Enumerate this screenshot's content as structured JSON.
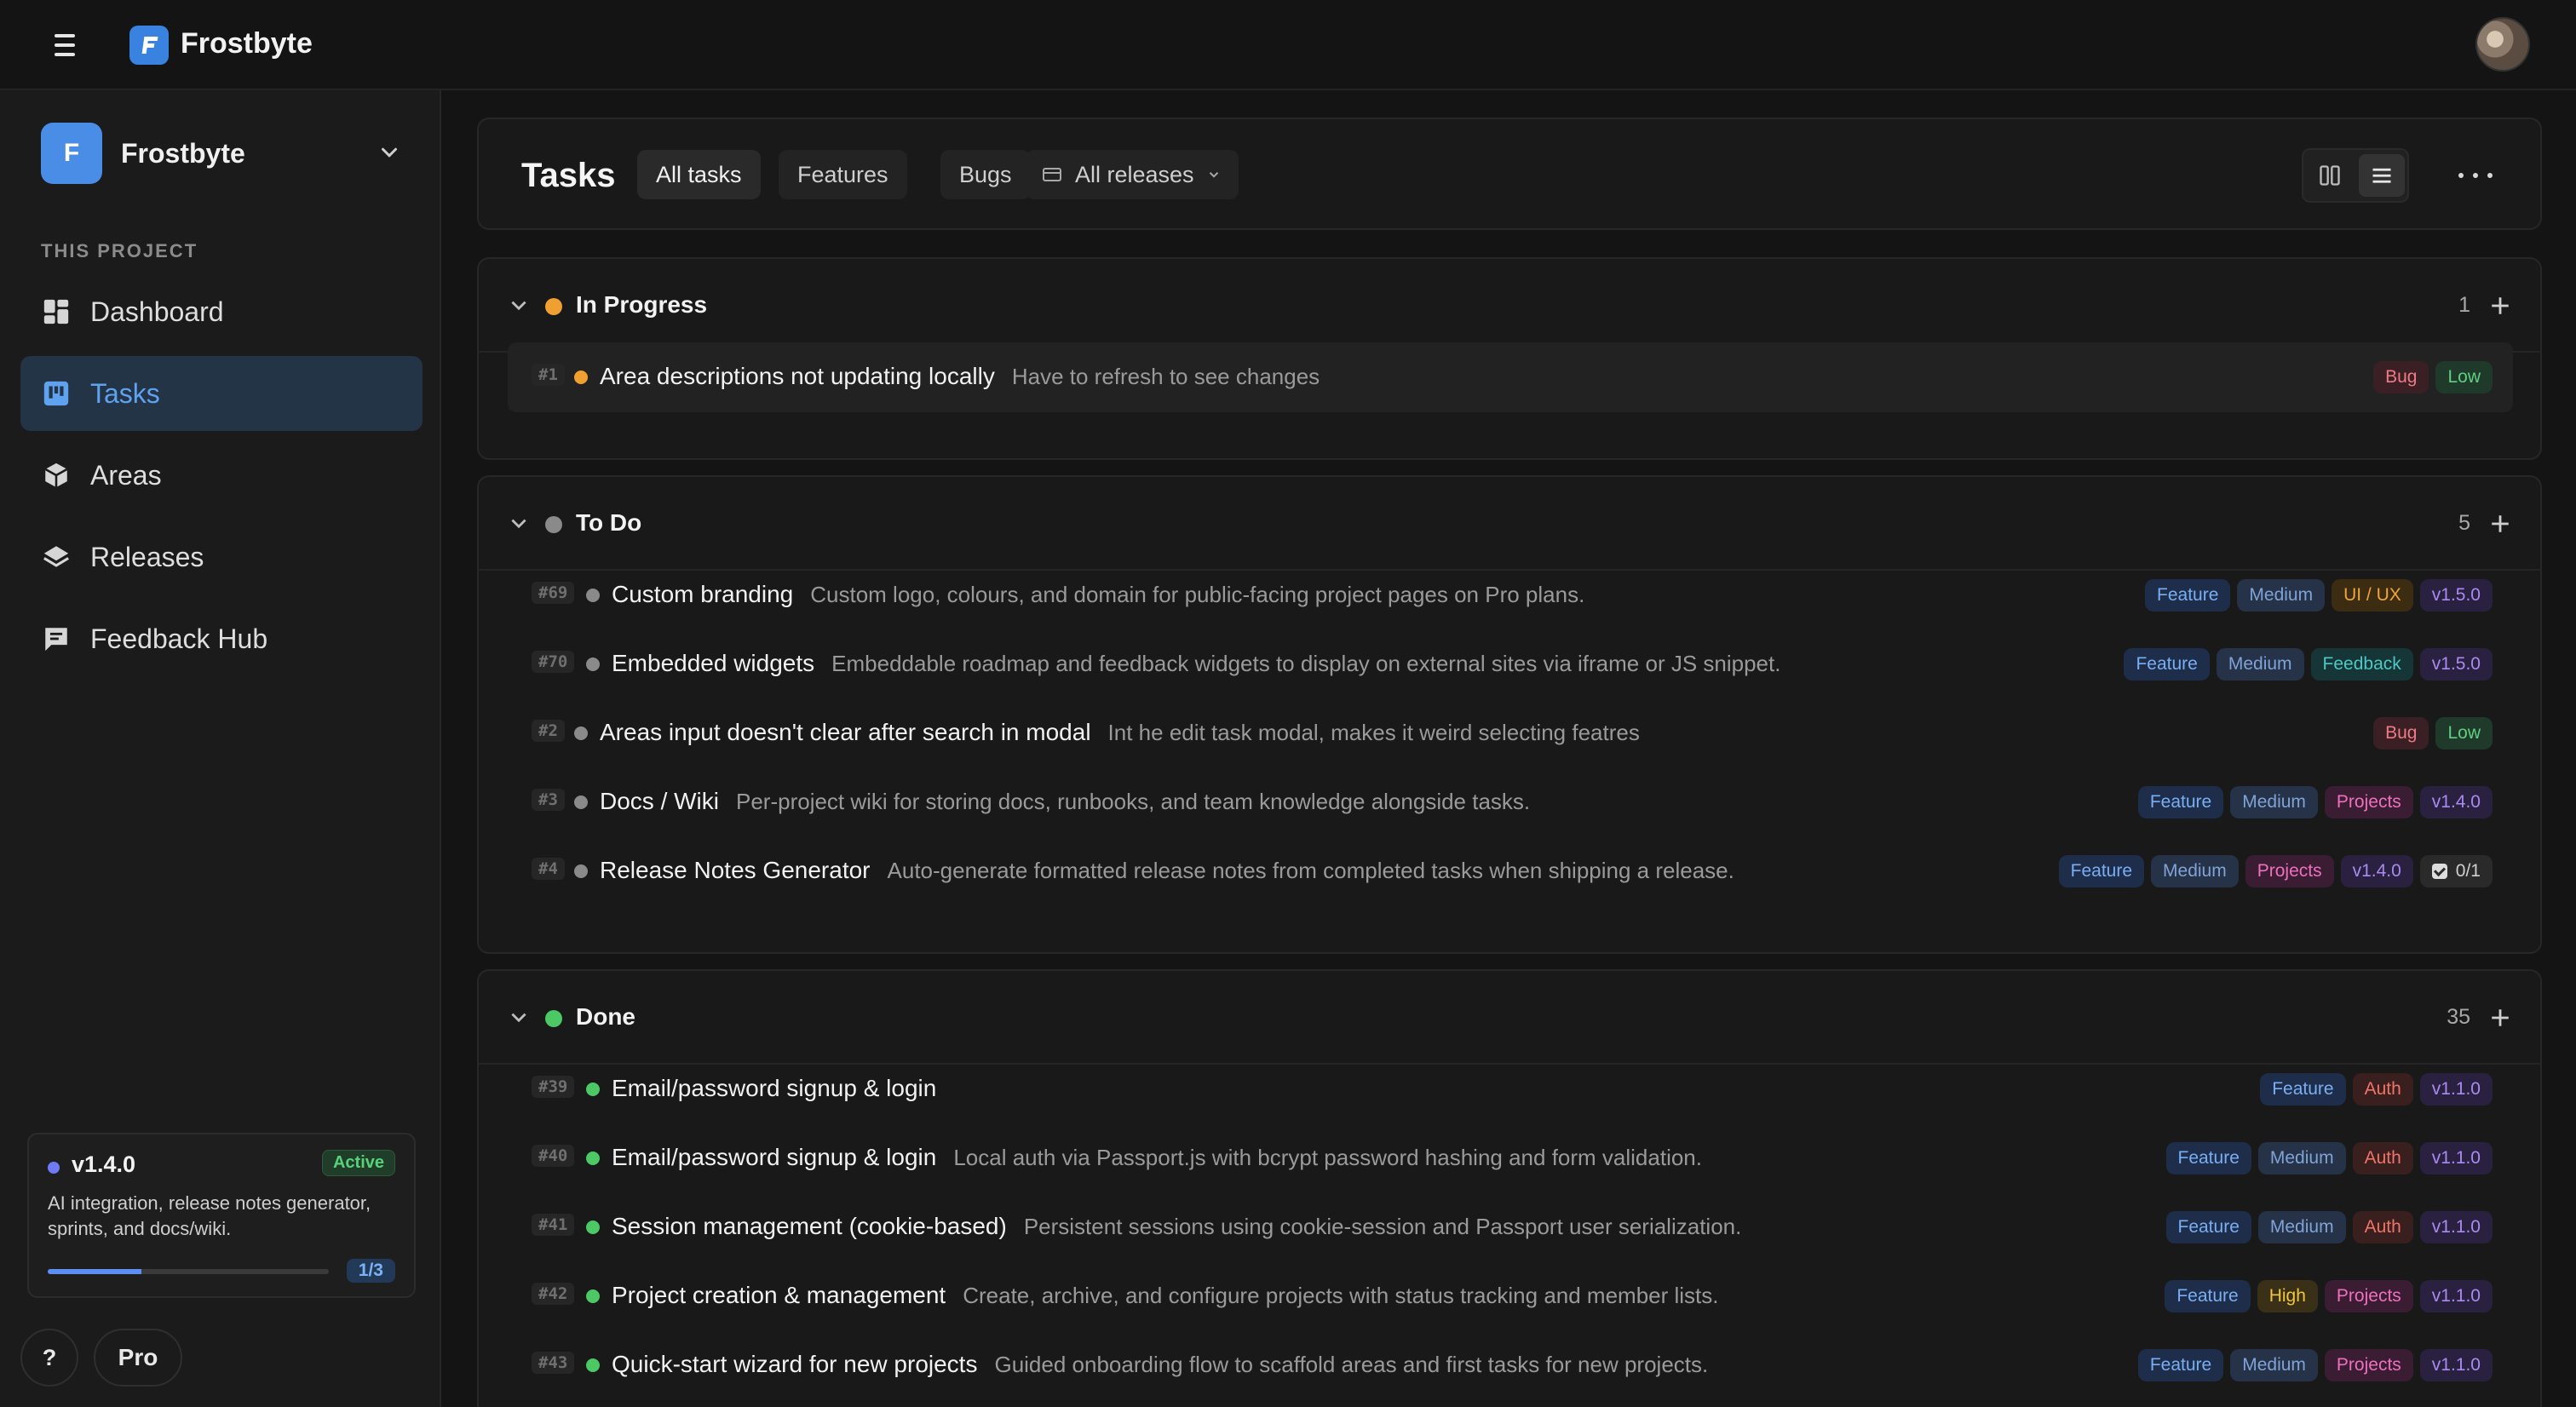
{
  "app": {
    "name": "Frostbyte"
  },
  "sidebar": {
    "project_initial": "F",
    "project_name": "Frostbyte",
    "section_label": "THIS PROJECT",
    "items": [
      {
        "label": "Dashboard",
        "icon": "dashboard-icon",
        "active": false
      },
      {
        "label": "Tasks",
        "icon": "kanban-icon",
        "active": true
      },
      {
        "label": "Areas",
        "icon": "cube-icon",
        "active": false
      },
      {
        "label": "Releases",
        "icon": "layers-icon",
        "active": false
      },
      {
        "label": "Feedback Hub",
        "icon": "chat-icon",
        "active": false
      }
    ],
    "release_card": {
      "version": "v1.4.0",
      "status": "Active",
      "description": "AI integration, release notes generator, sprints, and docs/wiki.",
      "progress_fraction": 0.333,
      "count": "1/3"
    },
    "help_label": "?",
    "pro_label": "Pro"
  },
  "main": {
    "title": "Tasks",
    "filters": [
      "All tasks",
      "Features",
      "Bugs"
    ],
    "release_filter": "All releases",
    "groups": [
      {
        "title": "In Progress",
        "color": "#f0a030",
        "count": "1",
        "rows": [
          {
            "id": "#1",
            "title": "Area descriptions not updating locally",
            "desc": "Have to refresh to see changes",
            "tags": [
              {
                "label": "Bug",
                "kind": "bug"
              },
              {
                "label": "Low",
                "kind": "low"
              }
            ]
          }
        ]
      },
      {
        "title": "To Do",
        "color": "#8a8a8a",
        "count": "5",
        "rows": [
          {
            "id": "#69",
            "title": "Custom branding",
            "desc": "Custom logo, colours, and domain for public-facing project pages on Pro plans.",
            "tags": [
              {
                "label": "Feature",
                "kind": "feature"
              },
              {
                "label": "Medium",
                "kind": "medium"
              },
              {
                "label": "UI / UX",
                "kind": "uiux"
              },
              {
                "label": "v1.5.0",
                "kind": "version"
              }
            ]
          },
          {
            "id": "#70",
            "title": "Embedded widgets",
            "desc": "Embeddable roadmap and feedback widgets to display on external sites via iframe or JS snippet.",
            "tags": [
              {
                "label": "Feature",
                "kind": "feature"
              },
              {
                "label": "Medium",
                "kind": "medium"
              },
              {
                "label": "Feedback",
                "kind": "feedback"
              },
              {
                "label": "v1.5.0",
                "kind": "version"
              }
            ]
          },
          {
            "id": "#2",
            "title": "Areas input doesn't clear after search in modal",
            "desc": "Int he edit task modal, makes it weird selecting featres",
            "tags": [
              {
                "label": "Bug",
                "kind": "bug"
              },
              {
                "label": "Low",
                "kind": "low"
              }
            ]
          },
          {
            "id": "#3",
            "title": "Docs / Wiki",
            "desc": "Per-project wiki for storing docs, runbooks, and team knowledge alongside tasks.",
            "tags": [
              {
                "label": "Feature",
                "kind": "feature"
              },
              {
                "label": "Medium",
                "kind": "medium"
              },
              {
                "label": "Projects",
                "kind": "projects"
              },
              {
                "label": "v1.4.0",
                "kind": "version"
              }
            ]
          },
          {
            "id": "#4",
            "title": "Release Notes Generator",
            "desc": "Auto-generate formatted release notes from completed tasks when shipping a release.",
            "tags": [
              {
                "label": "Feature",
                "kind": "feature"
              },
              {
                "label": "Medium",
                "kind": "medium"
              },
              {
                "label": "Projects",
                "kind": "projects"
              },
              {
                "label": "v1.4.0",
                "kind": "version"
              },
              {
                "label": "0/1",
                "kind": "check"
              }
            ]
          }
        ]
      },
      {
        "title": "Done",
        "color": "#4cc864",
        "count": "35",
        "rows": [
          {
            "id": "#39",
            "title": "Email/password signup & login",
            "desc": "",
            "tags": [
              {
                "label": "Feature",
                "kind": "feature"
              },
              {
                "label": "Auth",
                "kind": "auth"
              },
              {
                "label": "v1.1.0",
                "kind": "version"
              }
            ]
          },
          {
            "id": "#40",
            "title": "Email/password signup & login",
            "desc": "Local auth via Passport.js with bcrypt password hashing and form validation.",
            "tags": [
              {
                "label": "Feature",
                "kind": "feature"
              },
              {
                "label": "Medium",
                "kind": "medium"
              },
              {
                "label": "Auth",
                "kind": "auth"
              },
              {
                "label": "v1.1.0",
                "kind": "version"
              }
            ]
          },
          {
            "id": "#41",
            "title": "Session management (cookie-based)",
            "desc": "Persistent sessions using cookie-session and Passport user serialization.",
            "tags": [
              {
                "label": "Feature",
                "kind": "feature"
              },
              {
                "label": "Medium",
                "kind": "medium"
              },
              {
                "label": "Auth",
                "kind": "auth"
              },
              {
                "label": "v1.1.0",
                "kind": "version"
              }
            ]
          },
          {
            "id": "#42",
            "title": "Project creation & management",
            "desc": "Create, archive, and configure projects with status tracking and member lists.",
            "tags": [
              {
                "label": "Feature",
                "kind": "feature"
              },
              {
                "label": "High",
                "kind": "high"
              },
              {
                "label": "Projects",
                "kind": "projects"
              },
              {
                "label": "v1.1.0",
                "kind": "version"
              }
            ]
          },
          {
            "id": "#43",
            "title": "Quick-start wizard for new projects",
            "desc": "Guided onboarding flow to scaffold areas and first tasks for new projects.",
            "tags": [
              {
                "label": "Feature",
                "kind": "feature"
              },
              {
                "label": "Medium",
                "kind": "medium"
              },
              {
                "label": "Projects",
                "kind": "projects"
              },
              {
                "label": "v1.1.0",
                "kind": "version"
              }
            ]
          }
        ]
      }
    ]
  }
}
